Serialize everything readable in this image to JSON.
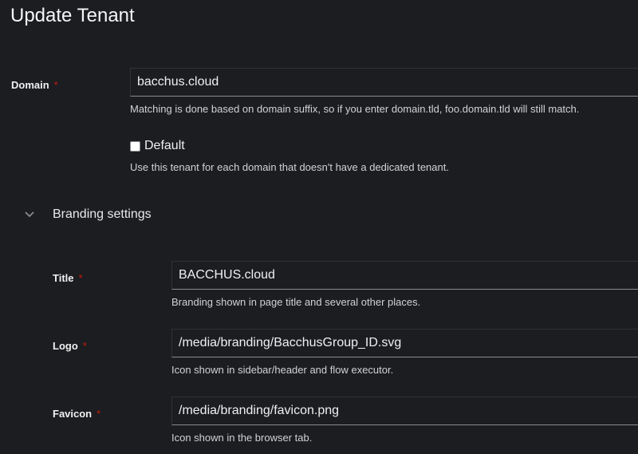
{
  "page": {
    "title": "Update Tenant"
  },
  "domain": {
    "label": "Domain",
    "required_mark": "*",
    "value": "bacchus.cloud",
    "helper": "Matching is done based on domain suffix, so if you enter domain.tld, foo.domain.tld will still match."
  },
  "default": {
    "label": "Default",
    "checked": false,
    "helper": "Use this tenant for each domain that doesn't have a dedicated tenant."
  },
  "branding": {
    "section_label": "Branding settings",
    "expanded": true,
    "title": {
      "label": "Title",
      "required_mark": "*",
      "value": "BACCHUS.cloud",
      "helper": "Branding shown in page title and several other places."
    },
    "logo": {
      "label": "Logo",
      "required_mark": "*",
      "value": "/media/branding/BacchusGroup_ID.svg",
      "helper": "Icon shown in sidebar/header and flow executor."
    },
    "favicon": {
      "label": "Favicon",
      "required_mark": "*",
      "value": "/media/branding/favicon.png",
      "helper": "Icon shown in the browser tab."
    }
  },
  "colors": {
    "required": "#c9190b",
    "background": "#1b1d21"
  }
}
